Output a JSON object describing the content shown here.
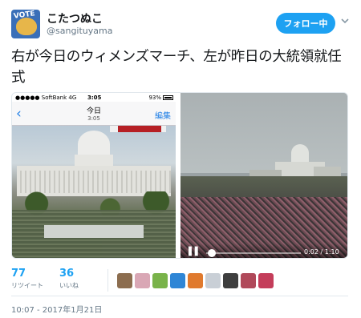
{
  "user": {
    "display_name": "こたつぬこ",
    "handle": "@sangituyama",
    "avatar_text": "VOTE"
  },
  "follow_button": {
    "label": "フォロー中"
  },
  "tweet": {
    "text": "右が今日のウィメンズマーチ、左が昨日の大統領就任式"
  },
  "media": {
    "left_screenshot": {
      "carrier": "●●●●● SoftBank 4G",
      "time": "3:05",
      "battery": "93%",
      "nav_title": "今日",
      "nav_subtitle": "3:05",
      "edit_label": "編集"
    },
    "video": {
      "time": "0:02 / 1:10",
      "progress": 0.03
    }
  },
  "stats": {
    "retweets_count": "77",
    "retweets_label": "リツイート",
    "likes_count": "36",
    "likes_label": "いいね",
    "liker_colors": [
      "#8c6d4f",
      "#d9a7b5",
      "#79b34a",
      "#2f86d6",
      "#e07a2e",
      "#c9cfd6",
      "#3e3e3e",
      "#b0495a",
      "#c43d5a"
    ]
  },
  "timestamp": "10:07 - 2017年1月21日"
}
